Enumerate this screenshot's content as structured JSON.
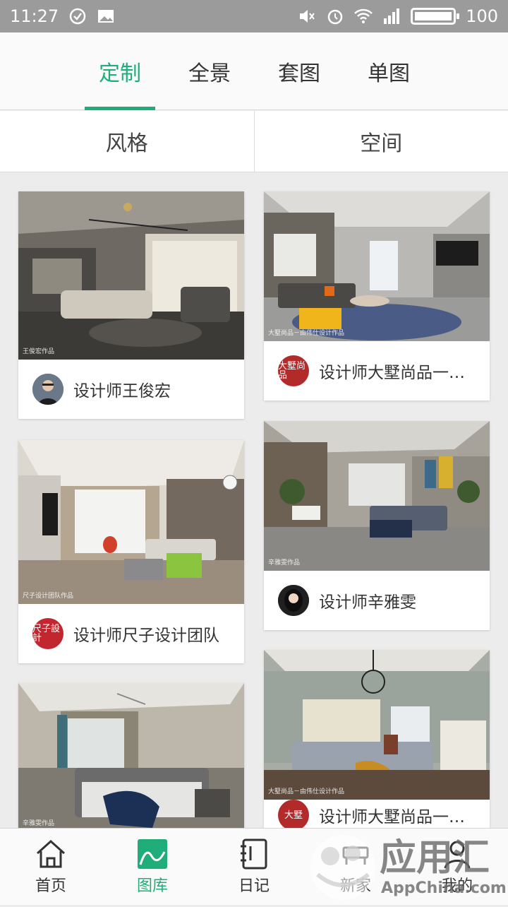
{
  "status_bar": {
    "time": "11:27",
    "battery": "100",
    "network": "4G"
  },
  "top_tabs": [
    {
      "label": "定制",
      "active": true
    },
    {
      "label": "全景",
      "active": false
    },
    {
      "label": "套图",
      "active": false
    },
    {
      "label": "单图",
      "active": false
    }
  ],
  "filters": [
    {
      "label": "风格"
    },
    {
      "label": "空间"
    }
  ],
  "cards": [
    {
      "designer": "设计师王俊宏",
      "photo_caption": "王俊宏作品"
    },
    {
      "designer": "设计师大墅尚品一由...",
      "photo_caption": "大墅尚品－由伟仕设计作品",
      "avatar_text": "大墅尚品"
    },
    {
      "designer": "设计师尺子设计团队",
      "photo_caption": "尺子设计团队作品",
      "avatar_text": "尺子設計"
    },
    {
      "designer": "设计师辛雅雯",
      "photo_caption": "辛雅雯作品"
    },
    {
      "designer": "",
      "photo_caption": "辛雅雯作品"
    },
    {
      "designer": "设计师大墅尚品一由...",
      "photo_caption": "大墅尚品－由伟仕设计作品",
      "avatar_text": "大墅"
    }
  ],
  "bottom_nav": [
    {
      "label": "首页",
      "icon": "home-icon",
      "active": false
    },
    {
      "label": "图库",
      "icon": "gallery-icon",
      "active": true
    },
    {
      "label": "日记",
      "icon": "diary-icon",
      "active": false
    },
    {
      "label": "新家",
      "icon": "new-home-icon",
      "active": false
    },
    {
      "label": "我的",
      "icon": "profile-icon",
      "active": false
    }
  ],
  "overlay_watermark": {
    "text": "应用汇",
    "subtext": "AppChina.com"
  },
  "colors": {
    "accent": "#1fae7a",
    "status_bar": "#9b9b9b",
    "background": "#ececec"
  }
}
